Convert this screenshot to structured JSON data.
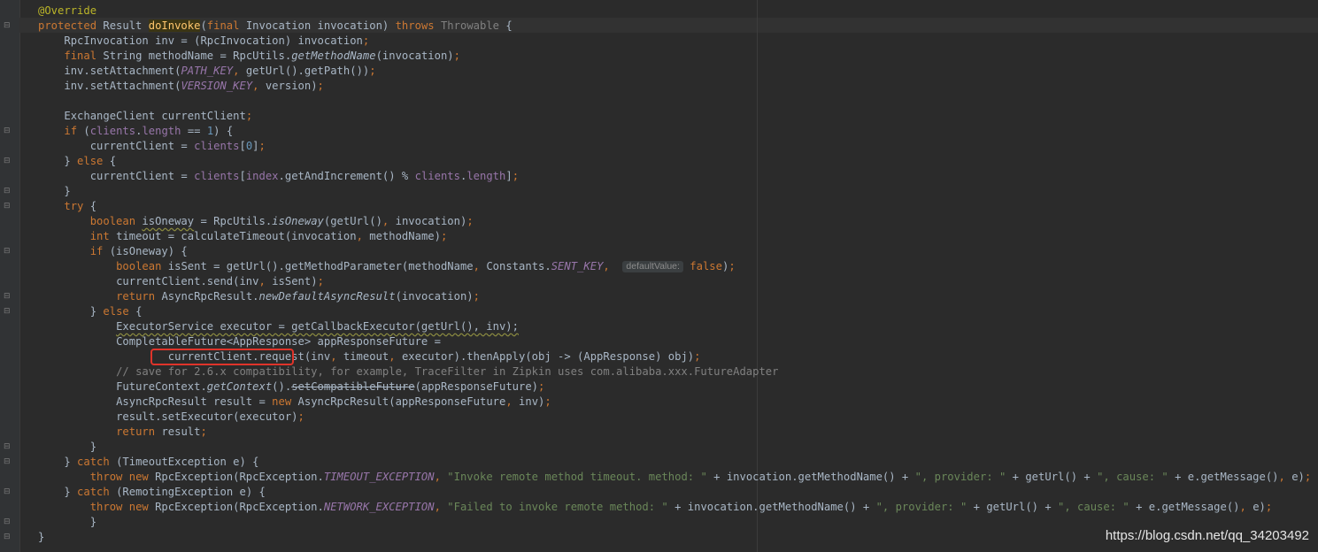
{
  "editor": {
    "code": [
      {
        "i": 0,
        "tokens": [
          {
            "t": "@Override",
            "c": "ann"
          }
        ]
      },
      {
        "i": 0,
        "tokens": [
          {
            "t": "protected ",
            "c": "kw"
          },
          {
            "t": "Result "
          },
          {
            "t": "doInvoke",
            "c": "fn hl"
          },
          {
            "t": "("
          },
          {
            "t": "final ",
            "c": "kw"
          },
          {
            "t": "Invocation invocation) "
          },
          {
            "t": "throws ",
            "c": "kw"
          },
          {
            "t": "Throwable ",
            "c": "ty"
          },
          {
            "t": "{"
          }
        ]
      },
      {
        "i": 1,
        "tokens": [
          {
            "t": "RpcInvocation inv = (RpcInvocation) invocation"
          },
          {
            "t": ";",
            "c": "kw"
          }
        ]
      },
      {
        "i": 1,
        "tokens": [
          {
            "t": "final ",
            "c": "kw"
          },
          {
            "t": "String methodName = RpcUtils."
          },
          {
            "t": "getMethodName",
            "c": "st"
          },
          {
            "t": "(invocation)"
          },
          {
            "t": ";",
            "c": "kw"
          }
        ]
      },
      {
        "i": 1,
        "tokens": [
          {
            "t": "inv.setAttachment("
          },
          {
            "t": "PATH_KEY",
            "c": "cst"
          },
          {
            "t": ", ",
            "c": "kw"
          },
          {
            "t": "getUrl().getPath())"
          },
          {
            "t": ";",
            "c": "kw"
          }
        ]
      },
      {
        "i": 1,
        "tokens": [
          {
            "t": "inv.setAttachment("
          },
          {
            "t": "VERSION_KEY",
            "c": "cst"
          },
          {
            "t": ", ",
            "c": "kw"
          },
          {
            "t": "version)"
          },
          {
            "t": ";",
            "c": "kw"
          }
        ]
      },
      {
        "i": 0,
        "tokens": []
      },
      {
        "i": 1,
        "tokens": [
          {
            "t": "ExchangeClient currentClient"
          },
          {
            "t": ";",
            "c": "kw"
          }
        ]
      },
      {
        "i": 1,
        "tokens": [
          {
            "t": "if ",
            "c": "kw"
          },
          {
            "t": "("
          },
          {
            "t": "clients",
            "c": "fld"
          },
          {
            "t": "."
          },
          {
            "t": "length ",
            "c": "fld"
          },
          {
            "t": "== "
          },
          {
            "t": "1",
            "c": "num"
          },
          {
            "t": ") {"
          }
        ]
      },
      {
        "i": 2,
        "tokens": [
          {
            "t": "currentClient = "
          },
          {
            "t": "clients",
            "c": "fld"
          },
          {
            "t": "["
          },
          {
            "t": "0",
            "c": "num"
          },
          {
            "t": "]"
          },
          {
            "t": ";",
            "c": "kw"
          }
        ]
      },
      {
        "i": 1,
        "tokens": [
          {
            "t": "} "
          },
          {
            "t": "else ",
            "c": "kw"
          },
          {
            "t": "{"
          }
        ]
      },
      {
        "i": 2,
        "tokens": [
          {
            "t": "currentClient = "
          },
          {
            "t": "clients",
            "c": "fld"
          },
          {
            "t": "["
          },
          {
            "t": "index",
            "c": "fld"
          },
          {
            "t": ".getAndIncrement() % "
          },
          {
            "t": "clients",
            "c": "fld"
          },
          {
            "t": "."
          },
          {
            "t": "length",
            "c": "fld"
          },
          {
            "t": "]"
          },
          {
            "t": ";",
            "c": "kw"
          }
        ]
      },
      {
        "i": 1,
        "tokens": [
          {
            "t": "}"
          }
        ]
      },
      {
        "i": 1,
        "tokens": [
          {
            "t": "try ",
            "c": "kw"
          },
          {
            "t": "{"
          }
        ]
      },
      {
        "i": 2,
        "tokens": [
          {
            "t": "boolean ",
            "c": "kw"
          },
          {
            "t": "isOneway",
            "c": "wavy"
          },
          {
            "t": " = RpcUtils."
          },
          {
            "t": "isOneway",
            "c": "st"
          },
          {
            "t": "(getUrl()"
          },
          {
            "t": ", ",
            "c": "kw"
          },
          {
            "t": "invocation)"
          },
          {
            "t": ";",
            "c": "kw"
          }
        ]
      },
      {
        "i": 2,
        "tokens": [
          {
            "t": "int ",
            "c": "kw"
          },
          {
            "t": "timeout = calculateTimeout(invocation"
          },
          {
            "t": ", ",
            "c": "kw"
          },
          {
            "t": "methodName)"
          },
          {
            "t": ";",
            "c": "kw"
          }
        ]
      },
      {
        "i": 2,
        "tokens": [
          {
            "t": "if ",
            "c": "kw"
          },
          {
            "t": "(isOneway) {"
          }
        ]
      },
      {
        "i": 3,
        "tokens": [
          {
            "t": "boolean ",
            "c": "kw"
          },
          {
            "t": "isSent = getUrl().getMethodParameter(methodName"
          },
          {
            "t": ", ",
            "c": "kw"
          },
          {
            "t": "Constants."
          },
          {
            "t": "SENT_KEY",
            "c": "cst"
          },
          {
            "t": ",  ",
            "c": "kw"
          },
          {
            "t": "defaultValue:",
            "c": "hint"
          },
          {
            "t": " "
          },
          {
            "t": "false",
            "c": "kw"
          },
          {
            "t": ")"
          },
          {
            "t": ";",
            "c": "kw"
          }
        ]
      },
      {
        "i": 3,
        "tokens": [
          {
            "t": "currentClient.send(inv"
          },
          {
            "t": ", ",
            "c": "kw"
          },
          {
            "t": "isSent)"
          },
          {
            "t": ";",
            "c": "kw"
          }
        ]
      },
      {
        "i": 3,
        "tokens": [
          {
            "t": "return ",
            "c": "kw"
          },
          {
            "t": "AsyncRpcResult."
          },
          {
            "t": "newDefaultAsyncResult",
            "c": "st"
          },
          {
            "t": "(invocation)"
          },
          {
            "t": ";",
            "c": "kw"
          }
        ]
      },
      {
        "i": 2,
        "tokens": [
          {
            "t": "} "
          },
          {
            "t": "else ",
            "c": "kw"
          },
          {
            "t": "{"
          }
        ]
      },
      {
        "i": 3,
        "tokens": [
          {
            "t": "ExecutorService executor = getCallbackExecutor(getUrl(), inv);",
            "c": "wavy"
          }
        ]
      },
      {
        "i": 3,
        "tokens": [
          {
            "t": "CompletableFuture<AppResponse> appResponseFuture ="
          }
        ]
      },
      {
        "i": 5,
        "tokens": [
          {
            "t": "currentClient.request(inv"
          },
          {
            "t": ", ",
            "c": "kw"
          },
          {
            "t": "timeout"
          },
          {
            "t": ", ",
            "c": "kw"
          },
          {
            "t": "executor).thenApply(obj -> (AppResponse) obj)"
          },
          {
            "t": ";",
            "c": "kw"
          }
        ]
      },
      {
        "i": 3,
        "tokens": [
          {
            "t": "// save for 2.6.x compatibility, for example, TraceFilter in Zipkin uses com.alibaba.xxx.FutureAdapter",
            "c": "cm"
          }
        ]
      },
      {
        "i": 3,
        "tokens": [
          {
            "t": "FutureContext."
          },
          {
            "t": "getContext",
            "c": "st"
          },
          {
            "t": "()."
          },
          {
            "t": "setCompatibleFuture",
            "c": "strike"
          },
          {
            "t": "(appResponseFuture)"
          },
          {
            "t": ";",
            "c": "kw"
          }
        ]
      },
      {
        "i": 3,
        "tokens": [
          {
            "t": "AsyncRpcResult result = "
          },
          {
            "t": "new ",
            "c": "kw"
          },
          {
            "t": "AsyncRpcResult(appResponseFuture"
          },
          {
            "t": ", ",
            "c": "kw"
          },
          {
            "t": "inv)"
          },
          {
            "t": ";",
            "c": "kw"
          }
        ]
      },
      {
        "i": 3,
        "tokens": [
          {
            "t": "result.setExecutor(executor)"
          },
          {
            "t": ";",
            "c": "kw"
          }
        ]
      },
      {
        "i": 3,
        "tokens": [
          {
            "t": "return ",
            "c": "kw"
          },
          {
            "t": "result"
          },
          {
            "t": ";",
            "c": "kw"
          }
        ]
      },
      {
        "i": 2,
        "tokens": [
          {
            "t": "}"
          }
        ]
      },
      {
        "i": 1,
        "tokens": [
          {
            "t": "} "
          },
          {
            "t": "catch ",
            "c": "kw"
          },
          {
            "t": "(TimeoutException e) {"
          }
        ]
      },
      {
        "i": 2,
        "tokens": [
          {
            "t": "throw new ",
            "c": "kw"
          },
          {
            "t": "RpcException(RpcException."
          },
          {
            "t": "TIMEOUT_EXCEPTION",
            "c": "cst"
          },
          {
            "t": ", ",
            "c": "kw"
          },
          {
            "t": "\"Invoke remote method timeout. method: \" ",
            "c": "str"
          },
          {
            "t": "+ invocation.getMethodName() + "
          },
          {
            "t": "\", provider: \" ",
            "c": "str"
          },
          {
            "t": "+ getUrl() + "
          },
          {
            "t": "\", cause: \" ",
            "c": "str"
          },
          {
            "t": "+ e.getMessage()"
          },
          {
            "t": ", ",
            "c": "kw"
          },
          {
            "t": "e)"
          },
          {
            "t": ";",
            "c": "kw"
          }
        ]
      },
      {
        "i": 1,
        "tokens": [
          {
            "t": "} "
          },
          {
            "t": "catch ",
            "c": "kw"
          },
          {
            "t": "(RemotingException e) {"
          }
        ]
      },
      {
        "i": 2,
        "tokens": [
          {
            "t": "throw new ",
            "c": "kw"
          },
          {
            "t": "RpcException(RpcException."
          },
          {
            "t": "NETWORK_EXCEPTION",
            "c": "cst"
          },
          {
            "t": ", ",
            "c": "kw"
          },
          {
            "t": "\"Failed to invoke remote method: \" ",
            "c": "str"
          },
          {
            "t": "+ invocation.getMethodName() + "
          },
          {
            "t": "\", provider: \" ",
            "c": "str"
          },
          {
            "t": "+ getUrl() + "
          },
          {
            "t": "\", cause: \" ",
            "c": "str"
          },
          {
            "t": "+ e.getMessage()"
          },
          {
            "t": ", ",
            "c": "kw"
          },
          {
            "t": "e)"
          },
          {
            "t": ";",
            "c": "kw"
          }
        ]
      },
      {
        "i": 2,
        "tokens": [
          {
            "t": "}"
          }
        ]
      },
      {
        "i": 0,
        "tokens": [
          {
            "t": "}"
          }
        ]
      }
    ]
  },
  "watermark": "https://blog.csdn.net/qq_34203492"
}
